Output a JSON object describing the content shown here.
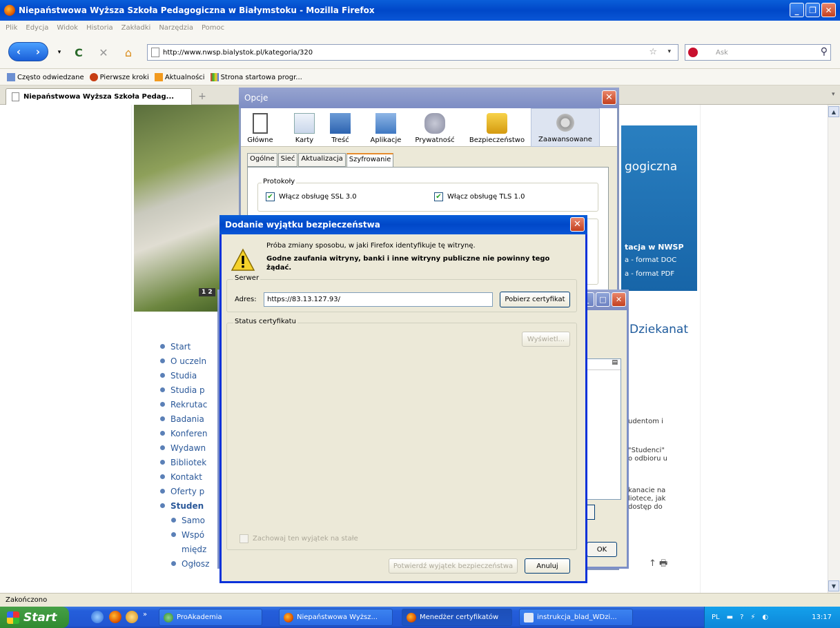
{
  "window": {
    "title": "Niepaństwowa Wyższa Szkoła Pedagogiczna w Białymstoku - Mozilla Firefox"
  },
  "menu": [
    "Plik",
    "Edycja",
    "Widok",
    "Historia",
    "Zakładki",
    "Narzędzia",
    "Pomoc"
  ],
  "nav": {
    "url": "http://www.nwsp.bialystok.pl/kategoria/320",
    "search_placeholder": "Ask"
  },
  "bookmarks": [
    "Często odwiedzane",
    "Pierwsze kroki",
    "Aktualności",
    "Strona startowa progr..."
  ],
  "tabs": [
    {
      "label": "Niepaństwowa Wyższa Szkoła Pedag..."
    }
  ],
  "page": {
    "site_title": "gogiczna",
    "links": [
      "tacja w NWSP",
      "a - format DOC",
      "a - format PDF"
    ],
    "slideshow": "1 2",
    "heading": "Dziekanat",
    "nav": [
      "Start",
      "O uczeln",
      "Studia",
      "Studia p",
      "Rekrutac",
      "Badania",
      "Konferen",
      "Wydawn",
      "Bibliotek",
      "Kontakt",
      "Oferty p",
      "Studen",
      "Samo",
      "Wspó",
      "międz",
      "Ogłosz"
    ],
    "right_text": [
      "udentom i",
      "\"Studenci\"",
      "o odbioru u",
      "kanacie na",
      "liotece, jak",
      "dostęp do"
    ],
    "page_icons": "↑ 🖶"
  },
  "status": "Zakończono",
  "opcje": {
    "title": "Opcje",
    "toolbar": [
      "Główne",
      "Karty",
      "Treść",
      "Aplikacje",
      "Prywatność",
      "Bezpieczeństwo",
      "Zaawansowane"
    ],
    "selected_tab": "Zaawansowane",
    "subtabs": [
      "Ogólne",
      "Sieć",
      "Aktualizacja",
      "Szyfrowanie"
    ],
    "selected_subtab": "Szyfrowanie",
    "protocols_label": "Protokoły",
    "ssl_label": "Włącz obsługę SSL 3.0",
    "tls_label": "Włącz obsługę TLS 1.0"
  },
  "certmgr": {
    "ok_label": "OK"
  },
  "exception_dialog": {
    "title": "Dodanie wyjątku bezpieczeństwa",
    "info_line": "Próba zmiany sposobu, w jaki Firefox identyfikuje tę witrynę.",
    "warning_bold": "Godne zaufania witryny, banki i inne witryny publiczne nie powinny tego żądać.",
    "server_label": "Serwer",
    "address_label": "Adres:",
    "address_value": "https://83.13.127.93/",
    "get_cert_label": "Pobierz certyfikat",
    "cert_status_label": "Status certyfikatu",
    "view_label": "Wyświetl...",
    "permanent_label": "Zachowaj ten wyjątek na stałe",
    "confirm_label": "Potwierdź wyjątek bezpieczeństwa",
    "cancel_label": "Anuluj"
  },
  "taskbar": {
    "start_label": "Start",
    "tasks": [
      "ProAkademia",
      "Niepaństwowa Wyższ...",
      "Menedżer certyfikatów",
      "instrukcja_blad_WDzi..."
    ],
    "lang": "PL",
    "clock": "13:17"
  },
  "colors": {
    "xp_blue": "#0047c8",
    "inactive_title": "#7d8dc4",
    "site_blue": "#1765a8"
  }
}
